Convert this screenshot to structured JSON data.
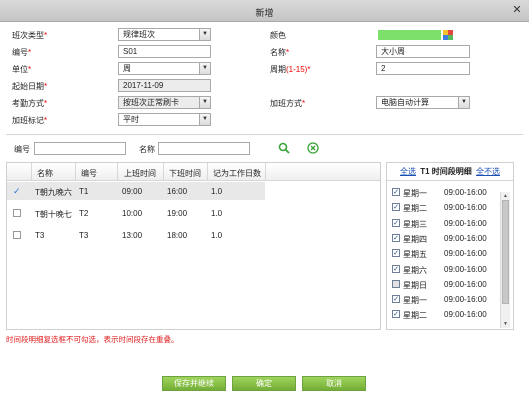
{
  "dialog": {
    "title": "新增",
    "close_glyph": "✕"
  },
  "form": {
    "shift_type": {
      "label": "班次类型",
      "value": "规律班次"
    },
    "color": {
      "label": "颜色",
      "swatch": "#7de06a"
    },
    "code": {
      "label": "编号",
      "value": "S01"
    },
    "name": {
      "label": "名称",
      "value": "大小周"
    },
    "unit": {
      "label": "单位",
      "value": "周"
    },
    "period": {
      "label": "周期",
      "hint": "(1-15)",
      "value": "2"
    },
    "start_date": {
      "label": "起始日期",
      "value": "2017-11-09"
    },
    "attendance_mode": {
      "label": "考勤方式",
      "value": "按班次正常刷卡"
    },
    "overtime_mode": {
      "label": "加班方式",
      "value": "电脑自动计算"
    },
    "overtime_flag": {
      "label": "加班标记",
      "value": "平时"
    },
    "required_mark": "*"
  },
  "search": {
    "code_label": "编号",
    "name_label": "名称",
    "code_value": "",
    "name_value": ""
  },
  "table": {
    "columns": [
      "名称",
      "编号",
      "上班时间",
      "下班时间",
      "记为工作日数"
    ],
    "rows": [
      {
        "checked": true,
        "name": "T朝九晚六",
        "code": "T1",
        "start": "09:00",
        "end": "16:00",
        "days": "1.0"
      },
      {
        "checked": false,
        "name": "T朝十晚七",
        "code": "T2",
        "start": "10:00",
        "end": "19:00",
        "days": "1.0"
      },
      {
        "checked": false,
        "name": "T3",
        "code": "T3",
        "start": "13:00",
        "end": "18:00",
        "days": "1.0"
      }
    ]
  },
  "detail": {
    "select_all": "全选",
    "title": "T1 时间段明细",
    "select_none": "全不选",
    "rows": [
      {
        "day": "星期一",
        "time": "09:00-16:00",
        "checked": true
      },
      {
        "day": "星期二",
        "time": "09:00-16:00",
        "checked": true
      },
      {
        "day": "星期三",
        "time": "09:00-16:00",
        "checked": true
      },
      {
        "day": "星期四",
        "time": "09:00-16:00",
        "checked": true
      },
      {
        "day": "星期五",
        "time": "09:00-16:00",
        "checked": true
      },
      {
        "day": "星期六",
        "time": "09:00-16:00",
        "checked": true
      },
      {
        "day": "星期日",
        "time": "09:00-16:00",
        "checked": false
      },
      {
        "day": "星期一",
        "time": "09:00-16:00",
        "checked": true
      },
      {
        "day": "星期二",
        "time": "09:00-16:00",
        "checked": true
      }
    ]
  },
  "warning": "时间段明细复选框不可勾选，表示时间段存在重叠。",
  "buttons": {
    "save_continue": "保存并继续",
    "ok": "确定",
    "cancel": "取消"
  },
  "colors": {
    "button_green": "#8bc34a",
    "link_blue": "#1a4fb3",
    "warning_red": "#e02020"
  }
}
